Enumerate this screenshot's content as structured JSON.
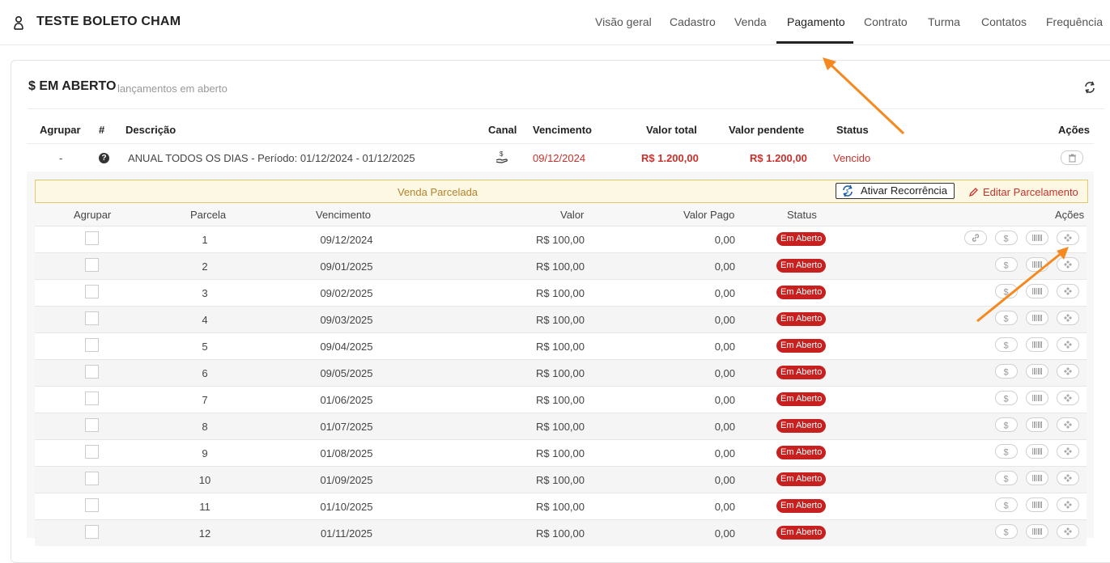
{
  "header": {
    "title": "TESTE BOLETO CHAM",
    "tabs": [
      {
        "label": "Visão geral"
      },
      {
        "label": "Cadastro"
      },
      {
        "label": "Venda"
      },
      {
        "label": "Pagamento",
        "active": true
      },
      {
        "label": "Contrato"
      },
      {
        "label": "Turma"
      },
      {
        "label": "Contatos"
      },
      {
        "label": "Frequência"
      }
    ]
  },
  "panel": {
    "title": "$ EM ABERTO",
    "subtitle": "lançamentos em aberto",
    "columns": {
      "agrupar": "Agrupar",
      "num": "#",
      "descricao": "Descrição",
      "canal": "Canal",
      "vencimento": "Vencimento",
      "valor_total": "Valor total",
      "valor_pendente": "Valor pendente",
      "status": "Status",
      "acoes": "Ações"
    },
    "entry": {
      "agrupar": "-",
      "num_icon": "question-circle-icon",
      "descricao": "ANUAL TODOS OS DIAS - Período: 01/12/2024 - 01/12/2025",
      "vencimento": "09/12/2024",
      "valor_total": "R$ 1.200,00",
      "valor_pendente": "R$ 1.200,00",
      "status": "Vencido"
    }
  },
  "installments": {
    "banner": "Venda Parcelada",
    "recurrence_button": "Ativar Recorrência",
    "edit_link": "Editar Parcelamento",
    "columns": {
      "agrupar": "Agrupar",
      "parcela": "Parcela",
      "vencimento": "Vencimento",
      "valor": "Valor",
      "valor_pago": "Valor Pago",
      "status": "Status",
      "acoes": "Ações"
    },
    "rows": [
      {
        "parcela": "1",
        "vencimento": "09/12/2024",
        "valor": "R$ 100,00",
        "valor_pago": "0,00",
        "status": "Em Aberto",
        "has_link": true
      },
      {
        "parcela": "2",
        "vencimento": "09/01/2025",
        "valor": "R$ 100,00",
        "valor_pago": "0,00",
        "status": "Em Aberto"
      },
      {
        "parcela": "3",
        "vencimento": "09/02/2025",
        "valor": "R$ 100,00",
        "valor_pago": "0,00",
        "status": "Em Aberto"
      },
      {
        "parcela": "4",
        "vencimento": "09/03/2025",
        "valor": "R$ 100,00",
        "valor_pago": "0,00",
        "status": "Em Aberto"
      },
      {
        "parcela": "5",
        "vencimento": "09/04/2025",
        "valor": "R$ 100,00",
        "valor_pago": "0,00",
        "status": "Em Aberto"
      },
      {
        "parcela": "6",
        "vencimento": "09/05/2025",
        "valor": "R$ 100,00",
        "valor_pago": "0,00",
        "status": "Em Aberto"
      },
      {
        "parcela": "7",
        "vencimento": "01/06/2025",
        "valor": "R$ 100,00",
        "valor_pago": "0,00",
        "status": "Em Aberto"
      },
      {
        "parcela": "8",
        "vencimento": "01/07/2025",
        "valor": "R$ 100,00",
        "valor_pago": "0,00",
        "status": "Em Aberto"
      },
      {
        "parcela": "9",
        "vencimento": "01/08/2025",
        "valor": "R$ 100,00",
        "valor_pago": "0,00",
        "status": "Em Aberto"
      },
      {
        "parcela": "10",
        "vencimento": "01/09/2025",
        "valor": "R$ 100,00",
        "valor_pago": "0,00",
        "status": "Em Aberto"
      },
      {
        "parcela": "11",
        "vencimento": "01/10/2025",
        "valor": "R$ 100,00",
        "valor_pago": "0,00",
        "status": "Em Aberto"
      },
      {
        "parcela": "12",
        "vencimento": "01/11/2025",
        "valor": "R$ 100,00",
        "valor_pago": "0,00",
        "status": "Em Aberto"
      }
    ]
  },
  "colors": {
    "accent_red": "#c9302c",
    "status_badge": "#c81f1f",
    "banner_bg": "#fcf8e3",
    "banner_text": "#b5832d",
    "annotation_arrow": "#f5891f"
  }
}
